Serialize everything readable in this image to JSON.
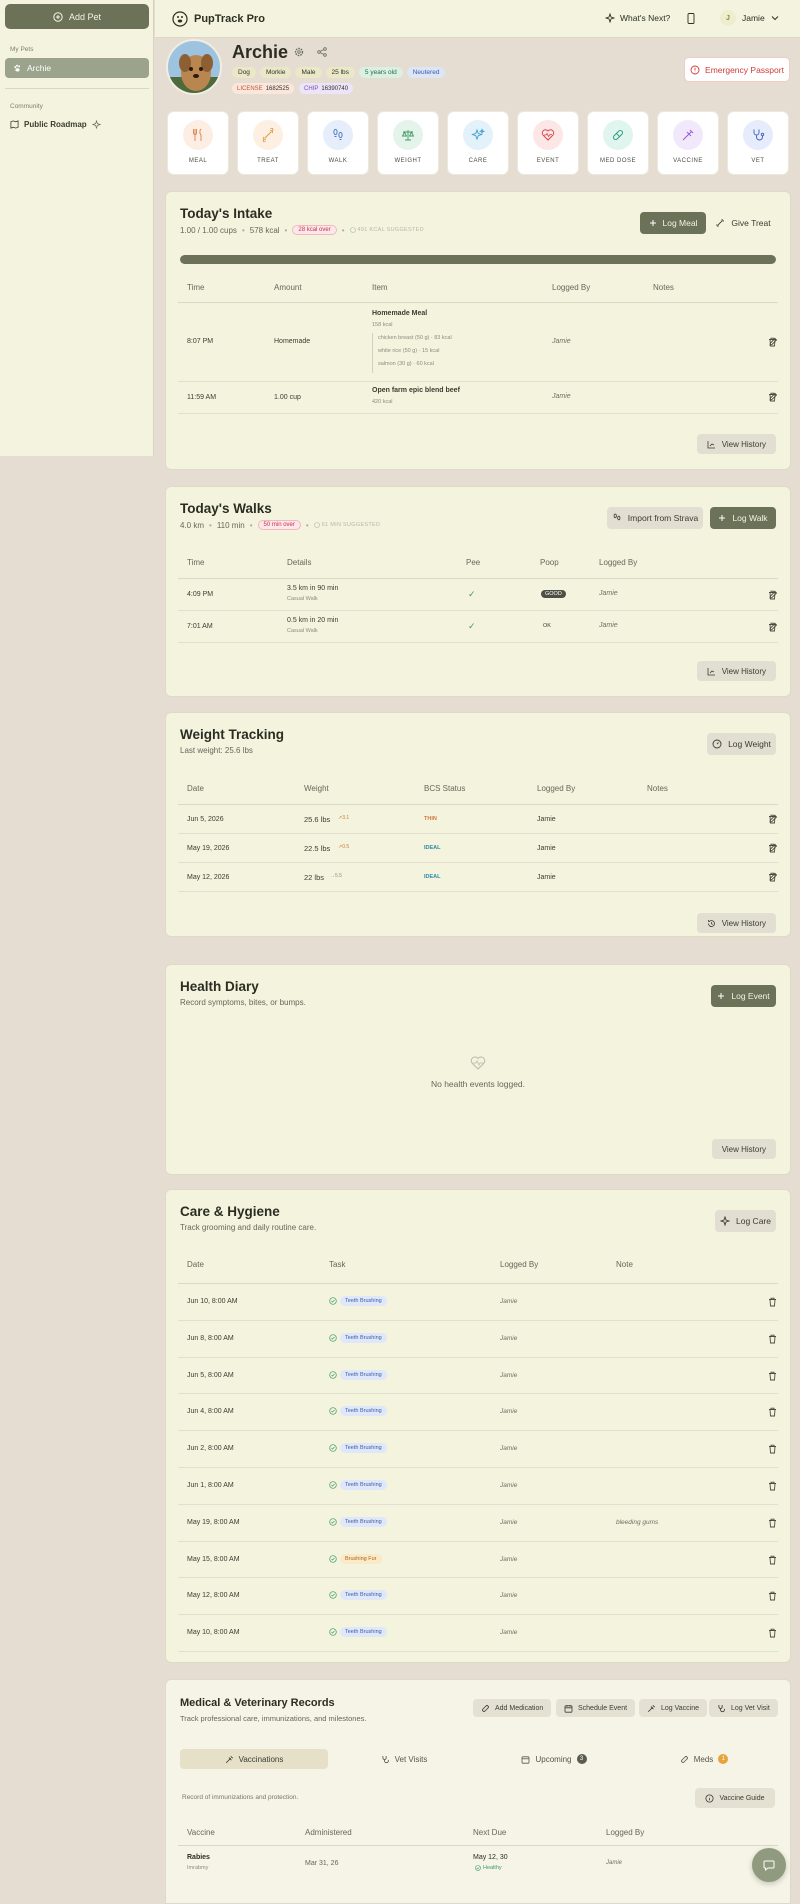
{
  "sidebar": {
    "add_pet": "Add Pet",
    "my_pets_label": "My Pets",
    "pets": [
      "Archie"
    ],
    "community_label": "Community",
    "roadmap": "Public Roadmap"
  },
  "topbar": {
    "brand": "PupTrack Pro",
    "whats_next": "What's Next?",
    "user_initial": "J",
    "user_name": "Jamie"
  },
  "pet": {
    "name": "Archie",
    "tags": [
      "Dog",
      "Morkie",
      "Male",
      "25 lbs",
      "5 years old",
      "Neutered"
    ],
    "license_label": "LICENSE",
    "license": "1682525",
    "chip_label": "CHIP",
    "chip": "16390740",
    "emergency": "Emergency Passport"
  },
  "quick_actions": [
    "MEAL",
    "TREAT",
    "WALK",
    "WEIGHT",
    "CARE",
    "EVENT",
    "MED DOSE",
    "VACCINE",
    "VET"
  ],
  "intake": {
    "title": "Today's Intake",
    "cups": "1.00 / 1.00 cups",
    "kcal": "578 kcal",
    "over": "28 kcal over",
    "suggested": "491 KCAL SUGGESTED",
    "progress": 1.0,
    "log_meal": "Log Meal",
    "give_treat": "Give Treat",
    "headers": [
      "Time",
      "Amount",
      "Item",
      "Logged By",
      "Notes"
    ],
    "rows": [
      {
        "time": "8:07 PM",
        "amount": "Homemade",
        "item": "Homemade Meal",
        "kcal": "158 kcal",
        "ingredients": [
          "chicken breast (50 g) · 83 kcal",
          "white rice (50 g) · 15 kcal",
          "salmon (30 g) · 60 kcal"
        ],
        "by": "Jamie"
      },
      {
        "time": "11:59 AM",
        "amount": "1.00 cup",
        "item": "Open farm epic blend beef",
        "kcal": "420 kcal",
        "ingredients": [],
        "by": "Jamie"
      }
    ],
    "view_history": "View History"
  },
  "walks": {
    "title": "Today's Walks",
    "distance": "4.0 km",
    "minutes": "110 min",
    "over": "50 min over",
    "suggested": "61 MIN SUGGESTED",
    "import": "Import from Strava",
    "log_walk": "Log Walk",
    "headers": [
      "Time",
      "Details",
      "Pee",
      "Poop",
      "Logged By"
    ],
    "rows": [
      {
        "time": "4:09 PM",
        "details": "3.5 km in 90 min",
        "type": "Casual Walk",
        "pee": "✓",
        "poop": "GOOD",
        "by": "Jamie"
      },
      {
        "time": "7:01 AM",
        "details": "0.5 km in 20 min",
        "type": "Casual Walk",
        "pee": "✓",
        "poop": "OK",
        "by": "Jamie"
      }
    ],
    "view_history": "View History"
  },
  "weight": {
    "title": "Weight Tracking",
    "last": "Last weight: 25.6 lbs",
    "log": "Log Weight",
    "headers": [
      "Date",
      "Weight",
      "BCS Status",
      "Logged By",
      "Notes"
    ],
    "rows": [
      {
        "date": "Jun 5, 2026",
        "weight": "25.6 lbs",
        "delta": "3.1",
        "bcs": "THIN",
        "by": "Jamie"
      },
      {
        "date": "May 19, 2026",
        "weight": "22.5 lbs",
        "delta": "0.5",
        "bcs": "IDEAL",
        "by": "Jamie"
      },
      {
        "date": "May 12, 2026",
        "weight": "22 lbs",
        "delta": "5.5",
        "bcs": "IDEAL",
        "by": "Jamie"
      }
    ],
    "view_history": "View History"
  },
  "diary": {
    "title": "Health Diary",
    "sub": "Record symptoms, bites, or bumps.",
    "log": "Log Event",
    "empty": "No health events logged.",
    "view_history": "View History"
  },
  "care": {
    "title": "Care & Hygiene",
    "sub": "Track grooming and daily routine care.",
    "log": "Log Care",
    "headers": [
      "Date",
      "Task",
      "Logged By",
      "Note"
    ],
    "rows": [
      {
        "date": "Jun 10, 8:00 AM",
        "task": "Teeth Brushing",
        "by": "Jamie",
        "note": ""
      },
      {
        "date": "Jun 8, 8:00 AM",
        "task": "Teeth Brushing",
        "by": "Jamie",
        "note": ""
      },
      {
        "date": "Jun 5, 8:00 AM",
        "task": "Teeth Brushing",
        "by": "Jamie",
        "note": ""
      },
      {
        "date": "Jun 4, 8:00 AM",
        "task": "Teeth Brushing",
        "by": "Jamie",
        "note": ""
      },
      {
        "date": "Jun 2, 8:00 AM",
        "task": "Teeth Brushing",
        "by": "Jamie",
        "note": ""
      },
      {
        "date": "Jun 1, 8:00 AM",
        "task": "Teeth Brushing",
        "by": "Jamie",
        "note": ""
      },
      {
        "date": "May 19, 8:00 AM",
        "task": "Teeth Brushing",
        "by": "Jamie",
        "note": "bleeding gums"
      },
      {
        "date": "May 15, 8:00 AM",
        "task": "Brushing Fur",
        "by": "Jamie",
        "note": ""
      },
      {
        "date": "May 12, 8:00 AM",
        "task": "Teeth Brushing",
        "by": "Jamie",
        "note": ""
      },
      {
        "date": "May 10, 8:00 AM",
        "task": "Teeth Brushing",
        "by": "Jamie",
        "note": ""
      }
    ]
  },
  "medical": {
    "title": "Medical & Veterinary Records",
    "sub": "Track professional care, immunizations, and milestones.",
    "buttons": [
      "Add Medication",
      "Schedule Event",
      "Log Vaccine",
      "Log Vet Visit"
    ],
    "tabs": [
      "Vaccinations",
      "Vet Visits",
      "Upcoming",
      "Meds"
    ],
    "upcoming_count": "3",
    "meds_count": "1",
    "section_desc": "Record of immunizations and protection.",
    "guide": "Vaccine Guide",
    "headers": [
      "Vaccine",
      "Administered",
      "Next Due",
      "Logged By"
    ],
    "rows": [
      {
        "vaccine": "Rabies",
        "brand": "Imrabmy",
        "administered": "Mar 31, 26",
        "next_due": "May 12, 30",
        "status": "Healthy",
        "by": "Jamie"
      }
    ]
  },
  "colors": {
    "primary": "#6b7257",
    "card": "#f3f3de",
    "bg": "#e5ddd2",
    "danger": "#d03a3a"
  }
}
